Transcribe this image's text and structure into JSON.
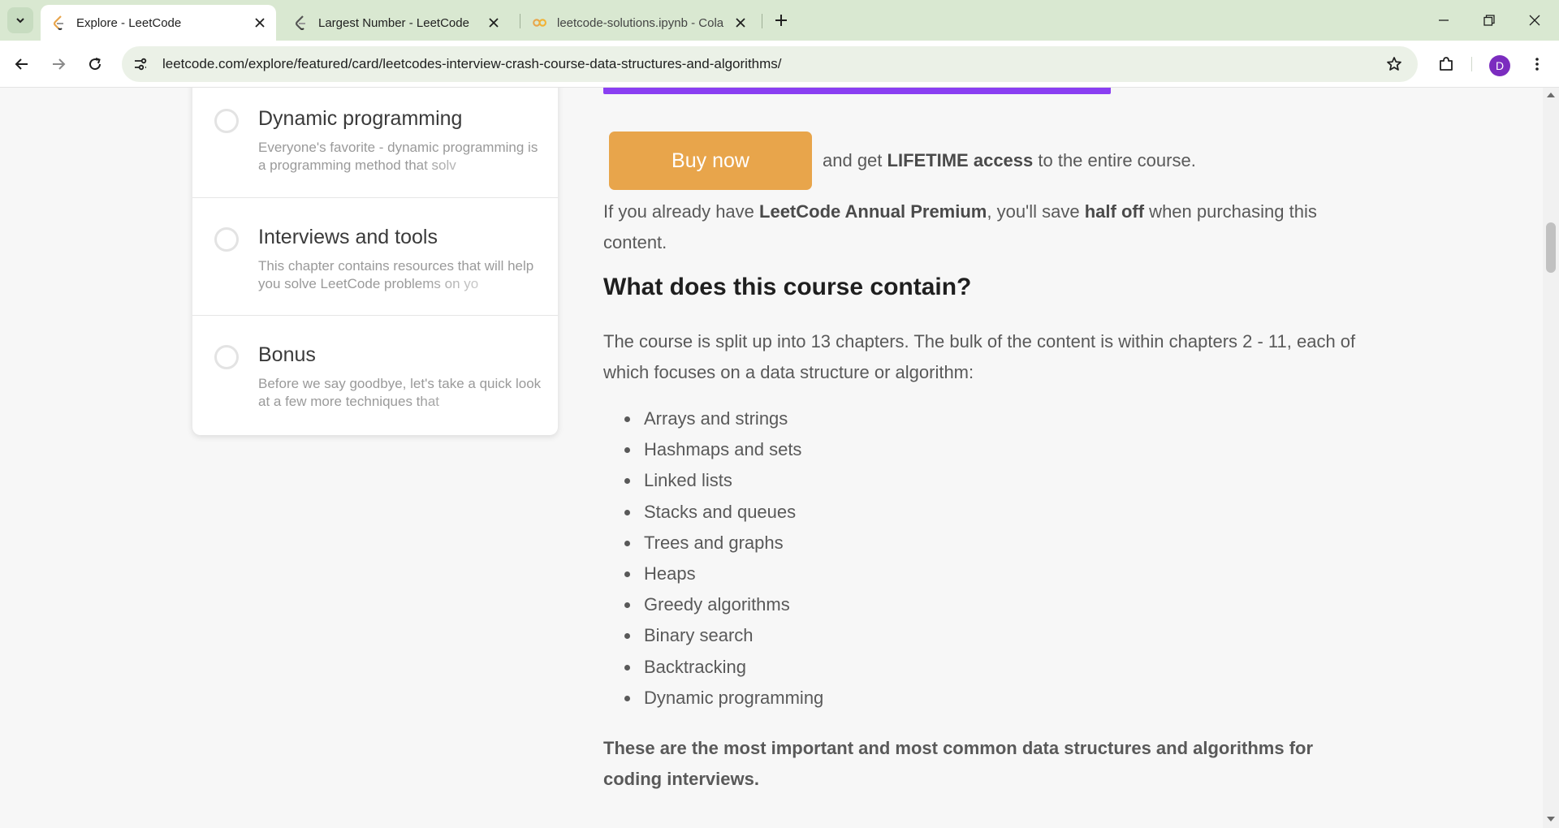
{
  "browser": {
    "tabs": [
      {
        "title": "Explore - LeetCode",
        "active": true,
        "icon": "leetcode-icon"
      },
      {
        "title": "Largest Number - LeetCode",
        "active": false,
        "icon": "leetcode-icon"
      },
      {
        "title": "leetcode-solutions.ipynb - Cola",
        "active": false,
        "icon": "colab-icon"
      }
    ],
    "url": "leetcode.com/explore/featured/card/leetcodes-interview-crash-course-data-structures-and-algorithms/",
    "profile_initial": "D"
  },
  "chapters": [
    {
      "title": "Dynamic programming",
      "description": "Everyone's favorite - dynamic programming is a programming method that solv"
    },
    {
      "title": "Interviews and tools",
      "description": "This chapter contains resources that will help you solve LeetCode problems on yo"
    },
    {
      "title": "Bonus",
      "description": "Before we say goodbye, let's take a quick look at a few more techniques that"
    }
  ],
  "purchase": {
    "button_label": "Buy now",
    "text_before": "and get ",
    "text_bold": "LIFETIME access",
    "text_after": " to the entire course.",
    "premium_before": "If you already have ",
    "premium_bold1": "LeetCode Annual Premium",
    "premium_middle": ", you'll save ",
    "premium_bold2": "half off",
    "premium_after": " when purchasing this content."
  },
  "course": {
    "heading": "What does this course contain?",
    "intro": "The course is split up into 13 chapters. The bulk of the content is within chapters 2 - 11, each of which focuses on a data structure or algorithm:",
    "topics": [
      "Arrays and strings",
      "Hashmaps and sets",
      "Linked lists",
      "Stacks and queues",
      "Trees and graphs",
      "Heaps",
      "Greedy algorithms",
      "Binary search",
      "Backtracking",
      "Dynamic programming"
    ],
    "closing": "These are the most important and most common data structures and algorithms for coding interviews."
  },
  "colors": {
    "accent_purple": "#8a3ff2",
    "buy_button": "#e8a54b",
    "tabbar": "#d9e8d1",
    "avatar": "#7b2cbf"
  }
}
